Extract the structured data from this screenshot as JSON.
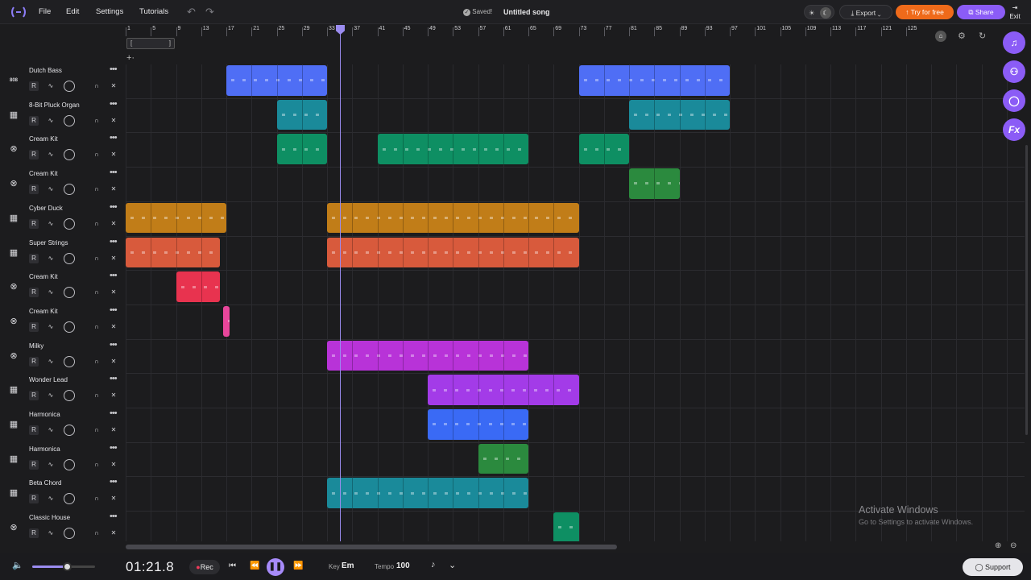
{
  "menu": [
    "File",
    "Edit",
    "Settings",
    "Tutorials"
  ],
  "status": {
    "saved": "Saved!",
    "title": "Untitled song"
  },
  "actions": {
    "export": "Export",
    "try": "Try for free",
    "share": "Share",
    "exit": "Exit"
  },
  "ruler": [
    "1",
    "5",
    "9",
    "13",
    "17",
    "21",
    "25",
    "29",
    "33",
    "37",
    "41",
    "45",
    "49",
    "53",
    "57",
    "61",
    "65",
    "69",
    "73",
    "77",
    "81",
    "85",
    "89",
    "93",
    "97",
    "101",
    "105",
    "109",
    "113",
    "117",
    "121",
    "125"
  ],
  "tracks": [
    {
      "name": "Dutch Bass",
      "icon": "808"
    },
    {
      "name": "8-Bit Pluck Organ",
      "icon": "keys"
    },
    {
      "name": "Cream Kit",
      "icon": "drum"
    },
    {
      "name": "Cream Kit",
      "icon": "drum"
    },
    {
      "name": "Cyber Duck",
      "icon": "keys"
    },
    {
      "name": "Super Strings",
      "icon": "keys"
    },
    {
      "name": "Cream Kit",
      "icon": "drum"
    },
    {
      "name": "Cream Kit",
      "icon": "drum"
    },
    {
      "name": "Milky",
      "icon": "drum"
    },
    {
      "name": "Wonder Lead",
      "icon": "keys"
    },
    {
      "name": "Harmonica",
      "icon": "keys"
    },
    {
      "name": "Harmonica",
      "icon": "keys"
    },
    {
      "name": "Beta Chord",
      "icon": "keys"
    },
    {
      "name": "Classic House",
      "icon": "drum"
    }
  ],
  "clips": [
    {
      "track": 0,
      "start": 17,
      "end": 33,
      "color": "#4f6ef5"
    },
    {
      "track": 0,
      "start": 73,
      "end": 97,
      "color": "#4f6ef5"
    },
    {
      "track": 1,
      "start": 25,
      "end": 33,
      "color": "#1a8a9a"
    },
    {
      "track": 1,
      "start": 81,
      "end": 97,
      "color": "#1a8a9a"
    },
    {
      "track": 2,
      "start": 25,
      "end": 33,
      "color": "#0e8f63"
    },
    {
      "track": 2,
      "start": 41,
      "end": 65,
      "color": "#0e8f63"
    },
    {
      "track": 2,
      "start": 73,
      "end": 81,
      "color": "#0e8f63"
    },
    {
      "track": 3,
      "start": 81,
      "end": 89,
      "color": "#2b8a3e"
    },
    {
      "track": 4,
      "start": 1,
      "end": 17,
      "color": "#c17d18"
    },
    {
      "track": 4,
      "start": 33,
      "end": 73,
      "color": "#c17d18"
    },
    {
      "track": 5,
      "start": 1,
      "end": 16,
      "color": "#d85a3c"
    },
    {
      "track": 5,
      "start": 33,
      "end": 73,
      "color": "#d85a3c"
    },
    {
      "track": 6,
      "start": 9,
      "end": 16,
      "color": "#e8334f"
    },
    {
      "track": 7,
      "start": 16.5,
      "end": 17.5,
      "color": "#e8469b"
    },
    {
      "track": 8,
      "start": 33,
      "end": 65,
      "color": "#b833d8"
    },
    {
      "track": 9,
      "start": 49,
      "end": 73,
      "color": "#a33be8"
    },
    {
      "track": 10,
      "start": 49,
      "end": 65,
      "color": "#3a6af5"
    },
    {
      "track": 11,
      "start": 57,
      "end": 65,
      "color": "#2b8a3e"
    },
    {
      "track": 12,
      "start": 33,
      "end": 65,
      "color": "#1a8a9a"
    },
    {
      "track": 13,
      "start": 69,
      "end": 73,
      "color": "#0e8f63"
    }
  ],
  "transport": {
    "time": "01:21.8",
    "rec": "Rec",
    "key_label": "Key",
    "key": "Em",
    "tempo_label": "Tempo",
    "tempo": "100"
  },
  "watermark": {
    "title": "Activate Windows",
    "sub": "Go to Settings to activate Windows."
  },
  "support": "Support",
  "volume": 0.55
}
